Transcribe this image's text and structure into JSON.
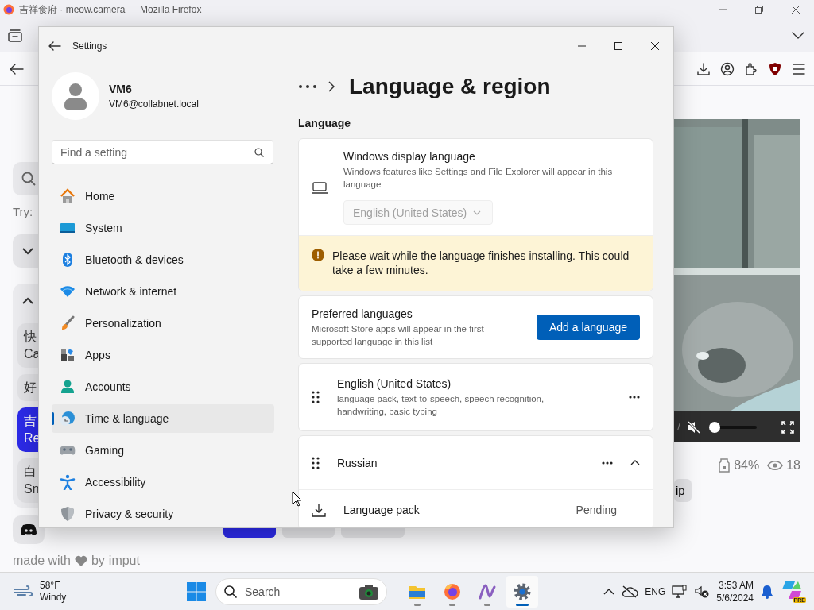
{
  "firefox": {
    "title": "吉祥食府 · meow.camera — Mozilla Firefox"
  },
  "page": {
    "try_label": "Try:",
    "list_items": [
      {
        "lines": [
          "快",
          "Ca"
        ],
        "selected": false
      },
      {
        "lines": [
          "好"
        ],
        "selected": false
      },
      {
        "lines": [
          "吉",
          "Re"
        ],
        "selected": true
      },
      {
        "lines": [
          "白",
          "Sn"
        ],
        "selected": false
      }
    ],
    "footer": {
      "text": "made with",
      "by": "by",
      "link": "imput"
    },
    "view_buttons": [
      {
        "selected": true
      },
      {
        "selected": false
      },
      {
        "selected": false
      }
    ],
    "video": {
      "kind": "picture",
      "time": "/",
      "muted": true,
      "volume": {
        "level": 0
      }
    },
    "stats": [
      {
        "kind": "battery",
        "value": "84%"
      },
      {
        "kind": "views",
        "value": "18"
      }
    ],
    "tip_button": "ip"
  },
  "settings": {
    "title": "Settings",
    "user": {
      "name": "VM6",
      "email": "VM6@collabnet.local"
    },
    "search": {
      "placeholder": "Find a setting"
    },
    "nav": [
      {
        "label": "Home",
        "kind": "home",
        "selected": false
      },
      {
        "label": "System",
        "kind": "system",
        "selected": false
      },
      {
        "label": "Bluetooth & devices",
        "kind": "bluetooth",
        "selected": false
      },
      {
        "label": "Network & internet",
        "kind": "network",
        "selected": false
      },
      {
        "label": "Personalization",
        "kind": "brush",
        "selected": false
      },
      {
        "label": "Apps",
        "kind": "apps",
        "selected": false
      },
      {
        "label": "Accounts",
        "kind": "accounts",
        "selected": false
      },
      {
        "label": "Time & language",
        "kind": "time",
        "selected": true
      },
      {
        "label": "Gaming",
        "kind": "gaming",
        "selected": false
      },
      {
        "label": "Accessibility",
        "kind": "accessibility",
        "selected": false
      },
      {
        "label": "Privacy & security",
        "kind": "privacy",
        "selected": false
      }
    ],
    "heading": "Language & region",
    "section": "Language",
    "display_language": {
      "title": "Windows display language",
      "description": "Windows features like Settings and File Explorer will appear in this language",
      "value": "English (United States)",
      "disabled": true
    },
    "warning": "Please wait while the language finishes installing. This could take a few minutes.",
    "preferred": {
      "title": "Preferred languages",
      "description": "Microsoft Store apps will appear in the first supported language in this list",
      "button": "Add a language"
    },
    "languages": [
      {
        "name": "English (United States)",
        "description": "language pack, text-to-speech, speech recognition, handwriting, basic typing",
        "expanded": false
      },
      {
        "name": "Russian",
        "expanded": true,
        "features": [
          {
            "name": "Language pack",
            "status": "Pending"
          }
        ]
      }
    ]
  },
  "taskbar": {
    "weather": {
      "temp": "58°F",
      "condition": "Windy"
    },
    "search_placeholder": "Search",
    "apps": [
      {
        "kind": "files",
        "running": true,
        "active": false
      },
      {
        "kind": "firefox",
        "running": true,
        "active": false
      },
      {
        "kind": "pen",
        "running": true,
        "active": false
      },
      {
        "kind": "settings",
        "running": true,
        "active": true
      }
    ],
    "language": "ENG",
    "time": "3:53 AM",
    "date": "5/6/2024",
    "copilot_badge": "PRE"
  }
}
